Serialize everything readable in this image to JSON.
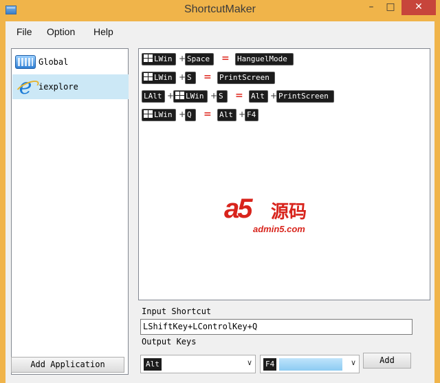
{
  "window": {
    "title": "ShortcutMaker",
    "controls": {
      "minimize": "–",
      "maximize": "□",
      "close": "✕"
    }
  },
  "menu": {
    "file": "File",
    "option": "Option",
    "help": "Help"
  },
  "applications": [
    {
      "label": "Global",
      "icon": "keyboard-icon",
      "selected": false
    },
    {
      "label": "iexplore",
      "icon": "internet-explorer-icon",
      "selected": true
    }
  ],
  "buttons": {
    "add_application": "Add Application",
    "add": "Add"
  },
  "mappings": [
    {
      "input": [
        "LWin",
        "Space"
      ],
      "output": [
        "HanguelMode"
      ]
    },
    {
      "input": [
        "LWin",
        "S"
      ],
      "output": [
        "PrintScreen"
      ]
    },
    {
      "input": [
        "LAlt",
        "LWin",
        "S"
      ],
      "output": [
        "Alt",
        "PrintScreen"
      ]
    },
    {
      "input": [
        "LWin",
        "Q"
      ],
      "output": [
        "Alt",
        "F4"
      ]
    }
  ],
  "symbols": {
    "plus": "+",
    "equals": "="
  },
  "watermark": {
    "brand": "a5",
    "cn": "源码",
    "site": "admin5.com"
  },
  "form": {
    "input_label": "Input Shortcut",
    "input_value": "LShiftKey+LControlKey+Q",
    "output_label": "Output Keys",
    "output_key_1": "Alt",
    "output_key_2": "F4"
  },
  "colors": {
    "title_bar": "#f0b44a",
    "token_bg": "#1c1c1c",
    "equals": "#e0342b",
    "selection": "#cce8f6",
    "close": "#c7453b"
  }
}
